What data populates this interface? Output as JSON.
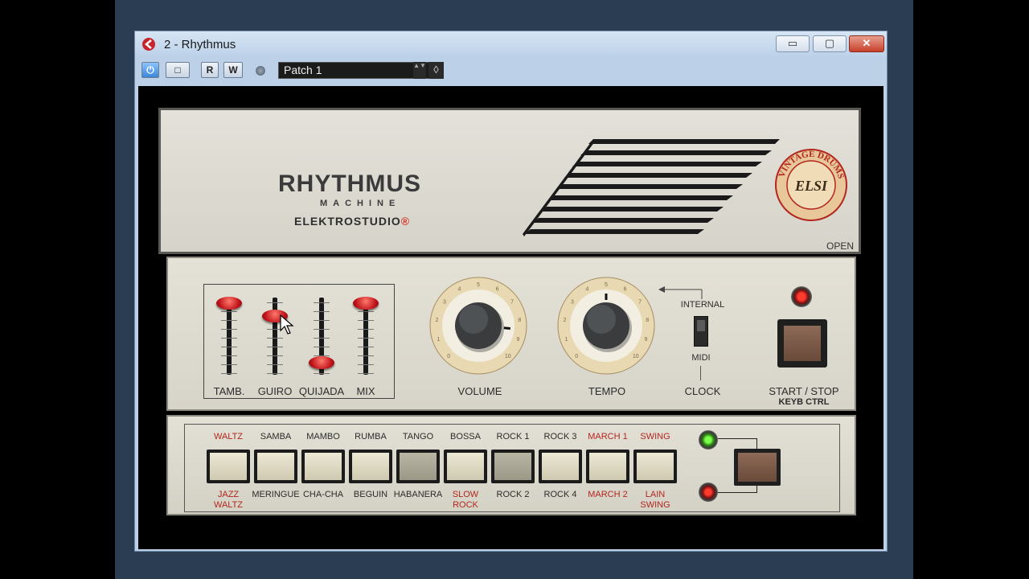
{
  "window": {
    "title": "2 - Rhythmus",
    "minimize_label": "▭",
    "maximize_label": "▢",
    "close_label": "✕"
  },
  "toolbar": {
    "power_label": "⏻",
    "bypass_label": "□",
    "read_label": "R",
    "write_label": "W",
    "preset_name": "Patch 1",
    "preset_arrows": "▲▼",
    "preset_menu": "◊"
  },
  "plugin": {
    "brand": "RHYTHMUS",
    "brand_sub": "MACHINE",
    "brand_maker": "ELEKTROSTUDIO",
    "brand_mark": "®",
    "open_label": "OPEN",
    "sliders": [
      {
        "label": "TAMB.",
        "level": 0.92
      },
      {
        "label": "GUIRO",
        "level": 0.75
      },
      {
        "label": "QUIJADA",
        "level": 0.1
      },
      {
        "label": "MIX",
        "level": 0.92
      }
    ],
    "volume_label": "VOLUME",
    "tempo_label": "TEMPO",
    "dial_numbers": [
      "0",
      "1",
      "2",
      "3",
      "4",
      "5",
      "6",
      "7",
      "8",
      "9",
      "10"
    ],
    "sync": {
      "internal": "INTERNAL",
      "midi": "MIDI",
      "clock": "CLOCK"
    },
    "start_stop_label": "START / STOP",
    "keyb_label": "KEYB CTRL",
    "rhythms_top": [
      {
        "label": "WALTZ",
        "red": true
      },
      {
        "label": "SAMBA",
        "red": false
      },
      {
        "label": "MAMBO",
        "red": false
      },
      {
        "label": "RUMBA",
        "red": false
      },
      {
        "label": "TANGO",
        "red": false
      },
      {
        "label": "BOSSA",
        "red": false
      },
      {
        "label": "ROCK 1",
        "red": false
      },
      {
        "label": "ROCK 3",
        "red": false
      },
      {
        "label": "MARCH 1",
        "red": true
      },
      {
        "label": "SWING",
        "red": true
      }
    ],
    "rhythms_bottom": [
      {
        "label": "JAZZ\nWALTZ",
        "red": true
      },
      {
        "label": "MERINGUE",
        "red": false
      },
      {
        "label": "CHA-CHA",
        "red": false
      },
      {
        "label": "BEGUIN",
        "red": false
      },
      {
        "label": "HABANERA",
        "red": false
      },
      {
        "label": "SLOW\nROCK",
        "red": true
      },
      {
        "label": "ROCK 2",
        "red": false
      },
      {
        "label": "ROCK 4",
        "red": false
      },
      {
        "label": "MARCH 2",
        "red": true
      },
      {
        "label": "LAIN\nSWING",
        "red": true
      }
    ],
    "badge_text": "VINTAGE DRUMS",
    "badge_center": "ELSI"
  },
  "colors": {
    "accent_red": "#b3261e",
    "panel": "#dcd9cf",
    "window_frame": "#bcd1e8"
  }
}
